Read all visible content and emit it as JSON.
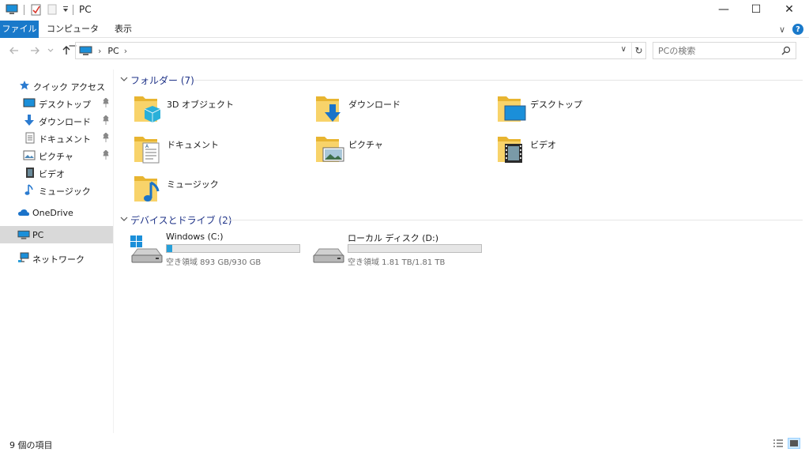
{
  "window": {
    "title": "PC",
    "controls": {
      "minimize": "—",
      "maximize": "☐",
      "close": "✕"
    }
  },
  "ribbon": {
    "tabs": [
      {
        "label": "ファイル"
      },
      {
        "label": "コンピューター"
      },
      {
        "label": "表示"
      }
    ],
    "collapse_glyph": "∨",
    "help_glyph": "?"
  },
  "address": {
    "location": "PC",
    "chevron": "›",
    "dropdown_glyph": "∨",
    "refresh_glyph": "↻"
  },
  "search": {
    "placeholder": "PCの検索"
  },
  "sidebar": {
    "items": [
      {
        "label": "クイック アクセス",
        "icon": "star-icon"
      },
      {
        "label": "デスクトップ",
        "icon": "desktop-icon",
        "pinned": true
      },
      {
        "label": "ダウンロード",
        "icon": "download-icon",
        "pinned": true
      },
      {
        "label": "ドキュメント",
        "icon": "document-icon",
        "pinned": true
      },
      {
        "label": "ピクチャ",
        "icon": "pictures-icon",
        "pinned": true
      },
      {
        "label": "ビデオ",
        "icon": "video-icon"
      },
      {
        "label": "ミュージック",
        "icon": "music-icon"
      },
      {
        "label": "OneDrive",
        "icon": "cloud-icon"
      },
      {
        "label": "PC",
        "icon": "computer-icon",
        "selected": true
      },
      {
        "label": "ネットワーク",
        "icon": "network-icon"
      }
    ]
  },
  "folders_group": {
    "title": "フォルダー (7)",
    "items": [
      {
        "label": "3D オブジェクト",
        "icon": "3d-objects-folder-icon"
      },
      {
        "label": "ダウンロード",
        "icon": "downloads-folder-icon"
      },
      {
        "label": "デスクトップ",
        "icon": "desktop-folder-icon"
      },
      {
        "label": "ドキュメント",
        "icon": "documents-folder-icon"
      },
      {
        "label": "ピクチャ",
        "icon": "pictures-folder-icon"
      },
      {
        "label": "ビデオ",
        "icon": "videos-folder-icon"
      },
      {
        "label": "ミュージック",
        "icon": "music-folder-icon"
      }
    ]
  },
  "drives_group": {
    "title": "デバイスとドライブ (2)",
    "items": [
      {
        "label": "Windows (C:)",
        "space": "空き領域 893 GB/930 GB",
        "used_fraction": 0.04,
        "icon": "windows-drive-icon"
      },
      {
        "label": "ローカル ディスク (D:)",
        "space": "空き領域 1.81 TB/1.81 TB",
        "used_fraction": 0.0,
        "icon": "local-disk-icon"
      }
    ]
  },
  "status": {
    "item_count": "9 個の項目"
  },
  "colors": {
    "accent": "#1979ca",
    "folder": "#f5c542",
    "group_title": "#1e3287",
    "drive_bar": "#26a0da",
    "selected_bg": "#d9d9d9"
  }
}
